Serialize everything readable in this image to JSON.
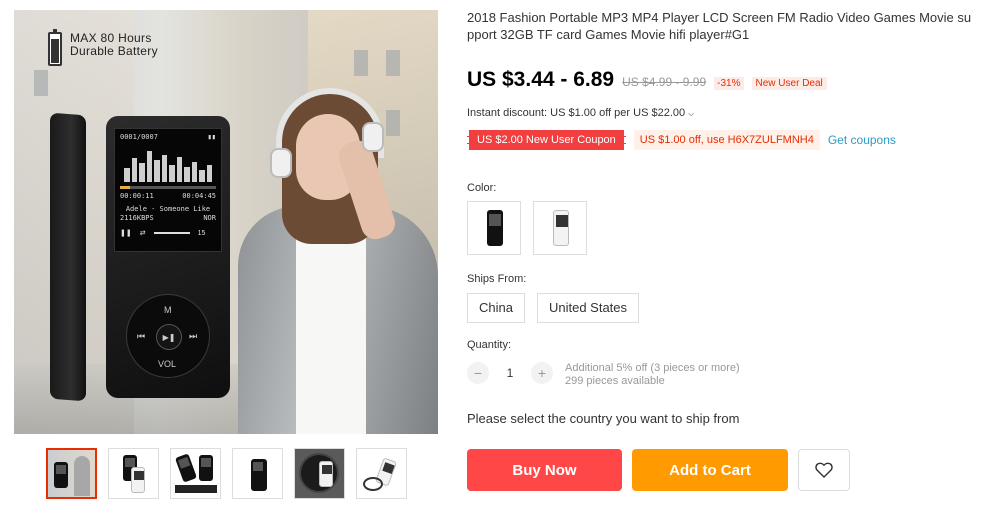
{
  "gallery": {
    "battery_badge": {
      "line1": "MAX 80 Hours",
      "line2": "Durable Battery"
    },
    "player_screen": {
      "track_index": "0001/0007",
      "time_elapsed": "00:00:11",
      "time_total": "00:04:45",
      "song": "Adele  - Someone Like",
      "bitrate": "2116KBPS",
      "mode": "NOR",
      "volume": "15"
    },
    "wheel_labels": {
      "top": "M",
      "bottom": "VOL"
    },
    "thumbnails": [
      {
        "kind": "lifestyle",
        "active": true
      },
      {
        "kind": "white-player"
      },
      {
        "kind": "accessories"
      },
      {
        "kind": "black-player"
      },
      {
        "kind": "vinyl"
      },
      {
        "kind": "earphones"
      }
    ]
  },
  "product": {
    "title": "2018 Fashion Portable MP3 MP4 Player LCD Screen FM Radio Video Games Movie su pport 32GB TF card Games Movie hifi player#G1",
    "price": "US $3.44 - 6.89",
    "original_price": "US $4.99 - 9.99",
    "discount_pct": "-31%",
    "new_user_deal": "New User Deal",
    "instant_discount": "Instant discount: US $1.00 off per US $22.00",
    "coupons": {
      "red": "US $2.00 New User Coupon",
      "light": "US $1.00 off, use H6X7ZULFMNH4",
      "link": "Get coupons"
    },
    "color_label": "Color:",
    "colors": [
      "black",
      "white"
    ],
    "ships_from_label": "Ships From:",
    "ships_from": [
      "China",
      "United States"
    ],
    "quantity_label": "Quantity:",
    "quantity": "1",
    "quantity_minus": "−",
    "quantity_plus": "+",
    "quantity_info_1": "Additional 5% off (3 pieces or more)",
    "quantity_info_2": "299 pieces available",
    "ship_note": "Please select the country you want to ship from",
    "buy_now": "Buy Now",
    "add_to_cart": "Add to Cart"
  },
  "colors": {
    "accent_red": "#ff4747",
    "accent_orange": "#ff9a00",
    "price_red": "#e62e04",
    "link_blue": "#2e9cc3"
  }
}
